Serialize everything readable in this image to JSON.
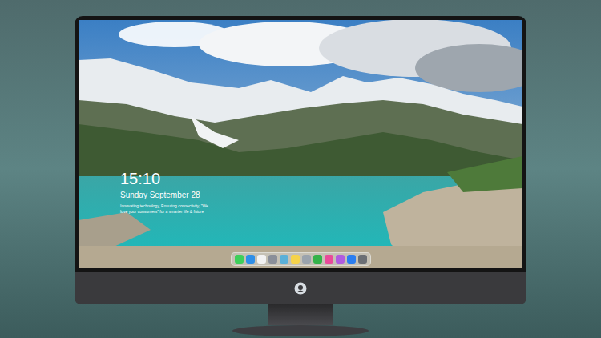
{
  "lock_screen": {
    "time": "15:10",
    "date": "Sunday September 28",
    "message": [
      "Innovating technology, Ensuring connectivity, \"We",
      "love your consumers\" for a smarter life & future"
    ]
  },
  "dock": {
    "items": [
      {
        "color": "#3ecf5a"
      },
      {
        "color": "#2f8fe8"
      },
      {
        "color": "#f2f2f2"
      },
      {
        "color": "#8a8f99"
      },
      {
        "color": "#5ab0d8"
      },
      {
        "color": "#f6d34a"
      },
      {
        "color": "#9aa3ad"
      },
      {
        "color": "#35b24a"
      },
      {
        "color": "#e94a9a"
      },
      {
        "color": "#b05ce0"
      },
      {
        "color": "#2b7ef0"
      },
      {
        "color": "#6b6f75"
      }
    ]
  }
}
